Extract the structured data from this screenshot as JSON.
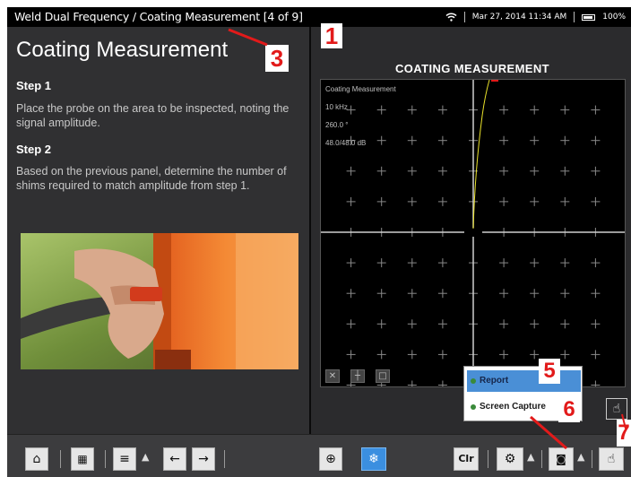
{
  "statusbar": {
    "breadcrumb": "Weld Dual Frequency  / Coating Measurement  [4 of 9]",
    "datetime": "Mar 27, 2014  11:34 AM",
    "battery": "100%",
    "wifi_icon": "wifi-icon",
    "battery_icon": "battery-icon"
  },
  "left": {
    "title": "Coating Measurement",
    "step1_heading": "Step 1",
    "step1_text": "Place the probe on the area to be inspected, noting the signal amplitude.",
    "step2_heading": "Step 2",
    "step2_text": "Based on the previous panel, determine the number of shims required to match amplitude from step 1."
  },
  "scope": {
    "title": "COATING MEASUREMENT",
    "readout": [
      "Coating Measurement",
      "10 kHz",
      "260.0 °",
      "48.0/48.0 dB"
    ]
  },
  "popup": {
    "items": [
      {
        "label": "Report",
        "selected": true
      },
      {
        "label": "Screen Capture",
        "selected": false
      }
    ]
  },
  "toolbar": {
    "clear_label": "Clr",
    "icons": [
      "home-icon",
      "apps-grid-icon",
      "menu-icon",
      "arrow-left-icon",
      "arrow-right-icon",
      "crosshair-icon",
      "freeze-snowflake-icon",
      "settings-icon",
      "camera-icon",
      "touch-icon"
    ]
  },
  "callouts": [
    "1",
    "3",
    "5",
    "6",
    "7"
  ],
  "colors": {
    "callout_text": "#e21a1a",
    "selected_menu": "#4a8fd6",
    "freeze_button": "#3b8fe0",
    "trace": "#e8e02a"
  }
}
